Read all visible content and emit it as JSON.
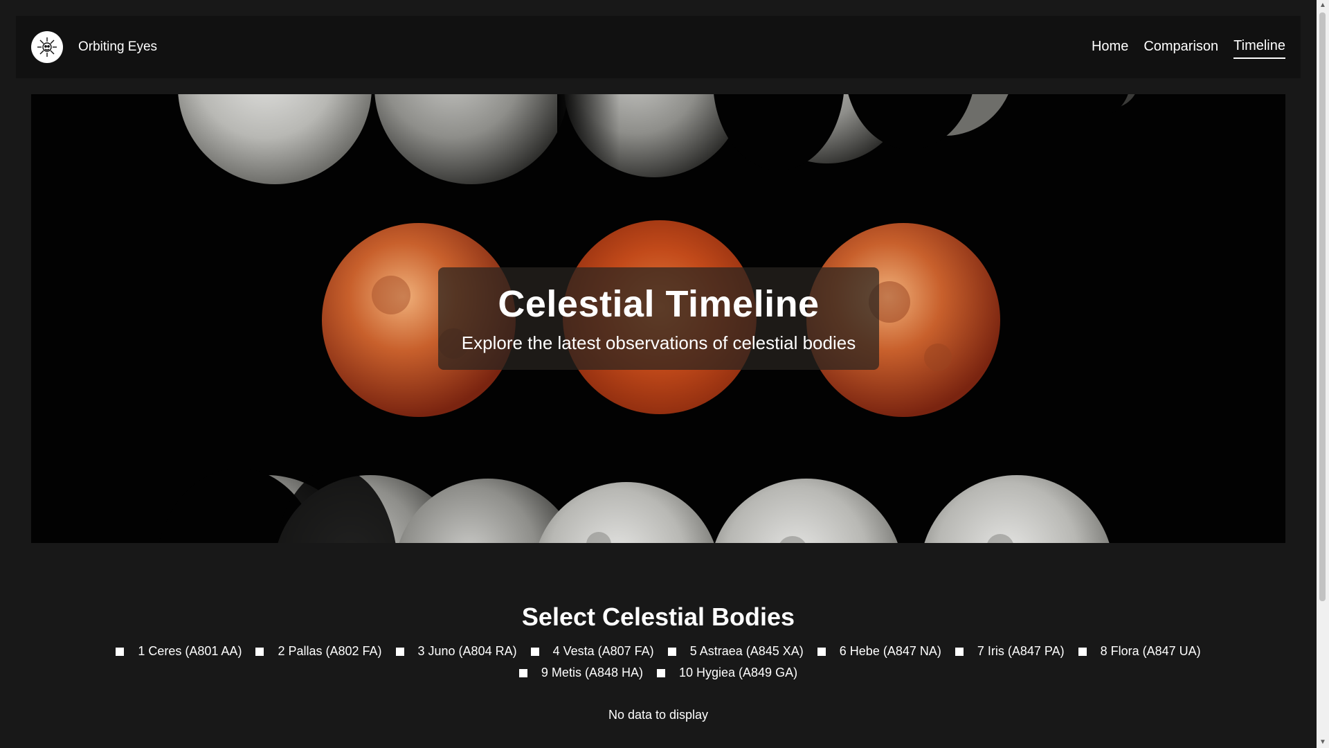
{
  "header": {
    "brand": "Orbiting Eyes",
    "logo_icon": "telescope-star-icon",
    "nav": [
      {
        "label": "Home",
        "active": false
      },
      {
        "label": "Comparison",
        "active": false
      },
      {
        "label": "Timeline",
        "active": true
      }
    ]
  },
  "hero": {
    "title": "Celestial Timeline",
    "subtitle": "Explore the latest observations of celestial bodies",
    "image": "lunar-eclipse-phases-photo"
  },
  "select": {
    "heading": "Select Celestial Bodies",
    "bodies": [
      "1 Ceres (A801 AA)",
      "2 Pallas (A802 FA)",
      "3 Juno (A804 RA)",
      "4 Vesta (A807 FA)",
      "5 Astraea (A845 XA)",
      "6 Hebe (A847 NA)",
      "7 Iris (A847 PA)",
      "8 Flora (A847 UA)",
      "9 Metis (A848 HA)",
      "10 Hygiea (A849 GA)"
    ],
    "empty_message": "No data to display"
  },
  "colors": {
    "page_background": "#181818",
    "header_background": "#111111",
    "text": "#ffffff"
  }
}
